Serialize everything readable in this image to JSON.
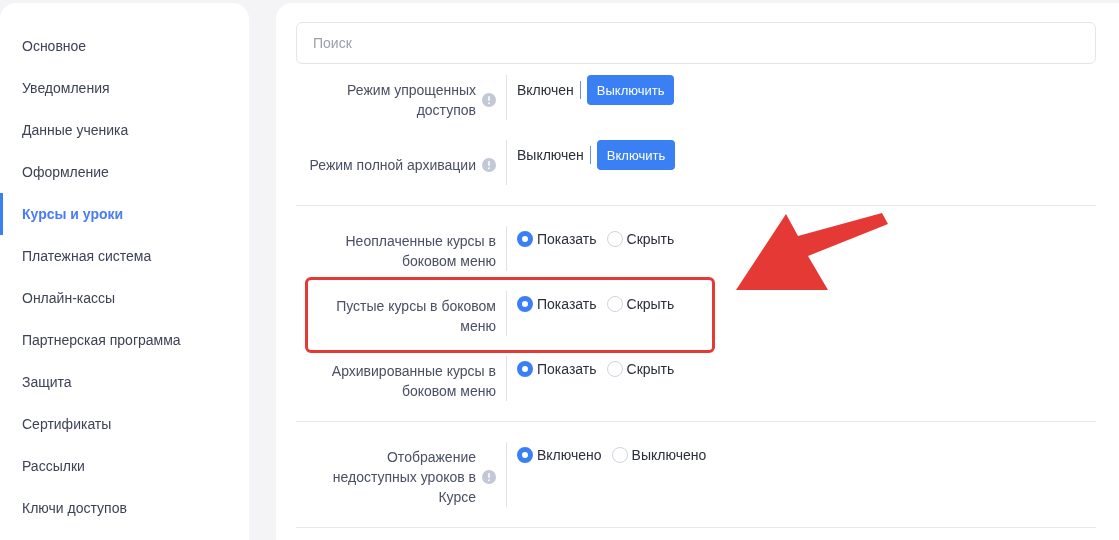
{
  "sidebar": {
    "items": [
      {
        "label": "Основное",
        "selected": false
      },
      {
        "label": "Уведомления",
        "selected": false
      },
      {
        "label": "Данные ученика",
        "selected": false
      },
      {
        "label": "Оформление",
        "selected": false
      },
      {
        "label": "Курсы и уроки",
        "selected": true
      },
      {
        "label": "Платежная система",
        "selected": false
      },
      {
        "label": "Онлайн-кассы",
        "selected": false
      },
      {
        "label": "Партнерская программа",
        "selected": false
      },
      {
        "label": "Защита",
        "selected": false
      },
      {
        "label": "Сертификаты",
        "selected": false
      },
      {
        "label": "Рассылки",
        "selected": false
      },
      {
        "label": "Ключи доступов",
        "selected": false
      }
    ]
  },
  "search": {
    "placeholder": "Поиск"
  },
  "sections": [
    {
      "rows": [
        {
          "kind": "toggle",
          "label": "Режим упрощенных доступов",
          "info": true,
          "status": "Включен",
          "button": "Выключить",
          "highlighted": false
        },
        {
          "kind": "toggle",
          "label": "Режим полной архивации",
          "info": true,
          "status": "Выключен",
          "button": "Включить",
          "highlighted": false
        }
      ]
    },
    {
      "rows": [
        {
          "kind": "radio",
          "label": "Неоплаченные курсы в боковом меню",
          "info": false,
          "highlighted": false,
          "options": [
            {
              "label": "Показать",
              "selected": true
            },
            {
              "label": "Скрыть",
              "selected": false
            }
          ]
        },
        {
          "kind": "radio",
          "label": "Пустые курсы в боковом меню",
          "info": false,
          "highlighted": true,
          "options": [
            {
              "label": "Показать",
              "selected": true
            },
            {
              "label": "Скрыть",
              "selected": false
            }
          ]
        },
        {
          "kind": "radio",
          "label": "Архивированные курсы в боковом меню",
          "info": false,
          "highlighted": false,
          "options": [
            {
              "label": "Показать",
              "selected": true
            },
            {
              "label": "Скрыть",
              "selected": false
            }
          ]
        }
      ]
    },
    {
      "rows": [
        {
          "kind": "radio",
          "label": "Отображение недоступных уроков в Курсе",
          "info": true,
          "highlighted": false,
          "options": [
            {
              "label": "Включено",
              "selected": true
            },
            {
              "label": "Выключено",
              "selected": false
            }
          ]
        }
      ]
    }
  ]
}
